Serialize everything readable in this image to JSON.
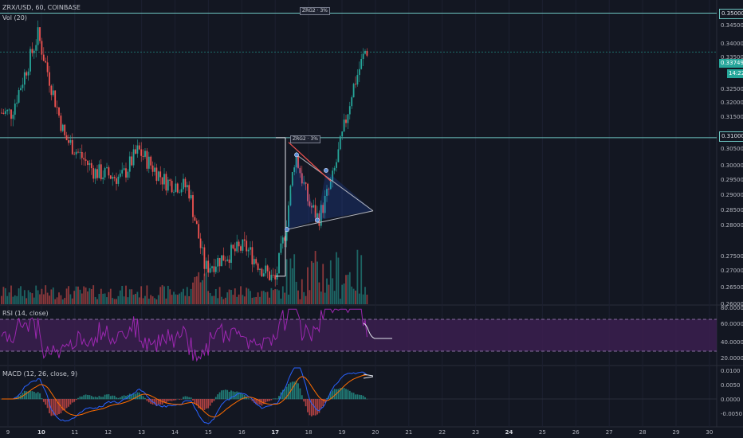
{
  "header": {
    "title": "ZRX/USD, 60, COINBASE",
    "vol": "Vol (20)"
  },
  "rsi": {
    "title": "RSI (14, close)",
    "levels": [
      "80.0000",
      "60.0000",
      "40.0000",
      "20.0000"
    ]
  },
  "macd": {
    "title": "MACD (12, 26, close, 9)",
    "levels": [
      "0.0100",
      "0.0050",
      "0.0000",
      "-0.0050"
    ]
  },
  "price_axis": [
    "0.345000",
    "0.340000",
    "0.335000",
    "0.325000",
    "0.320000",
    "0.315000",
    "0.305000",
    "0.300000",
    "0.295000",
    "0.290000",
    "0.285000",
    "0.280000",
    "0.275000",
    "0.270000",
    "0.265000",
    "0.260000"
  ],
  "price_tags": {
    "top": "0.350000",
    "current": "0.337497",
    "countdown": "14:22",
    "mid": "0.310000"
  },
  "pattern_labels": {
    "top": "ZRG2 · 3%",
    "mid": "ZRG2 · 3%"
  },
  "dates": [
    "9",
    "10",
    "11",
    "12",
    "13",
    "14",
    "15",
    "16",
    "17",
    "18",
    "19",
    "20",
    "21",
    "22",
    "23",
    "24",
    "25",
    "26",
    "27",
    "28",
    "29",
    "30"
  ],
  "colors": {
    "up": "#26a69a",
    "down": "#ef5350",
    "level": "#6ec6c2",
    "rsi_band": "#3b1f4f"
  },
  "chart_data": {
    "type": "candlestick",
    "title": "ZRX/USD, 60, COINBASE",
    "x_range": [
      "9",
      "20"
    ],
    "ylim": [
      0.255,
      0.352
    ],
    "horizontal_levels": [
      0.35,
      0.31
    ],
    "last_price": 0.337497,
    "key_points": [
      {
        "day": 9.1,
        "price": 0.318
      },
      {
        "day": 9.9,
        "price": 0.343
      },
      {
        "day": 10.7,
        "price": 0.31
      },
      {
        "day": 11.6,
        "price": 0.299
      },
      {
        "day": 12.4,
        "price": 0.297
      },
      {
        "day": 12.9,
        "price": 0.306
      },
      {
        "day": 13.7,
        "price": 0.296
      },
      {
        "day": 14.4,
        "price": 0.294
      },
      {
        "day": 14.9,
        "price": 0.268
      },
      {
        "day": 15.5,
        "price": 0.272
      },
      {
        "day": 16.1,
        "price": 0.275
      },
      {
        "day": 16.6,
        "price": 0.268
      },
      {
        "day": 17.0,
        "price": 0.264
      },
      {
        "day": 17.3,
        "price": 0.28
      },
      {
        "day": 17.6,
        "price": 0.305
      },
      {
        "day": 18.0,
        "price": 0.289
      },
      {
        "day": 18.3,
        "price": 0.284
      },
      {
        "day": 18.7,
        "price": 0.296
      },
      {
        "day": 19.0,
        "price": 0.31
      },
      {
        "day": 19.3,
        "price": 0.325
      },
      {
        "day": 19.7,
        "price": 0.338
      }
    ]
  }
}
